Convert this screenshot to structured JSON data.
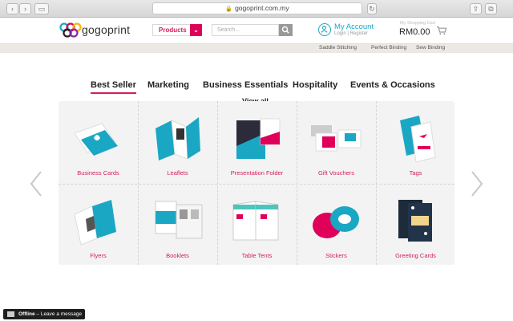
{
  "browser": {
    "url": "gogoprint.com.my"
  },
  "header": {
    "logo_text": "gogoprint",
    "products_label": "Products",
    "search_placeholder": "Search...",
    "account_title": "My Account",
    "account_sub": "Login | Register",
    "cart_label": "My Shopping Cart",
    "cart_total": "RM0.00"
  },
  "subnav": [
    "Saddle Stitching",
    "Perfect Binding",
    "Sew Binding"
  ],
  "tabs": [
    {
      "label": "Best Seller",
      "active": true
    },
    {
      "label": "Marketing"
    },
    {
      "label": "Business Essentials"
    },
    {
      "label": "Hospitality"
    },
    {
      "label": "Events & Occasions"
    }
  ],
  "view_all": "View all",
  "products": [
    {
      "label": "Business Cards"
    },
    {
      "label": "Leaflets"
    },
    {
      "label": "Presentation Folder"
    },
    {
      "label": "Gift Vouchers"
    },
    {
      "label": "Tags"
    },
    {
      "label": "Flyers"
    },
    {
      "label": "Booklets"
    },
    {
      "label": "Table Tents"
    },
    {
      "label": "Stickers"
    },
    {
      "label": "Greeting Cards"
    }
  ],
  "chat": {
    "status": "Offline",
    "message": "Leave a message"
  },
  "colors": {
    "brand_pink": "#d81b60",
    "accent_teal": "#1aa7c4",
    "grid_bg": "#f3f3f3"
  }
}
